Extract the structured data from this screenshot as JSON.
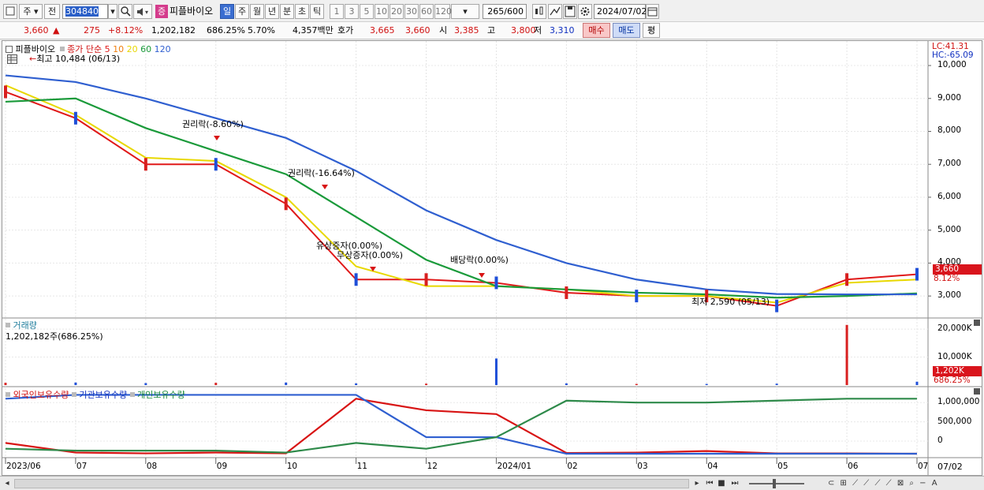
{
  "toolbar": {
    "market_label": "주",
    "prev_label": "전",
    "stock_code": "304840",
    "stock_tag": "증",
    "stock_name": "피플바이오",
    "period_tabs": [
      "일",
      "주",
      "월",
      "년",
      "분",
      "초",
      "틱"
    ],
    "selected_period": "일",
    "interval_buttons": [
      "1",
      "3",
      "5",
      "10",
      "20",
      "30",
      "60",
      "120"
    ],
    "count_display": "265",
    "count_total": "/600",
    "date_value": "2024/07/02"
  },
  "quote": {
    "price": "3,660",
    "change_arrow": "▲",
    "change": "275",
    "change_pct": "+8.12%",
    "volume": "1,202,182",
    "volume_ratio": "686.25%",
    "turnover": "5.70%",
    "amount": "4,357백만",
    "bid_label": "호가",
    "ask_price": "3,665",
    "bid_price": "3,660",
    "open_label": "시",
    "open": "3,385",
    "high_label": "고",
    "high": "3,800",
    "low_label": "저",
    "low": "3,310",
    "buy_button": "매수",
    "sell_button": "매도",
    "eval_button": "평"
  },
  "price_pane": {
    "name": "피플바이오",
    "ma_label": "종가 단순",
    "ma_periods": [
      {
        "label": "5",
        "color": "#e01818"
      },
      {
        "label": "10",
        "color": "#f08010"
      },
      {
        "label": "20",
        "color": "#e8d800"
      },
      {
        "label": "60",
        "color": "#1a9a3a"
      },
      {
        "label": "120",
        "color": "#2f5fd0"
      }
    ],
    "high_marker": "최고 10,484 (06/13)",
    "low_marker": "최저 2,590 (05/13)",
    "events": [
      "권리락(-8.60%)",
      "권리락(-16.64%)",
      "유상증자(0.00%)",
      "무상증자(0.00%)",
      "배당락(0.00%)"
    ],
    "lc_label": "LC:41.31",
    "hc_label": "HC:-65.09",
    "y_ticks": [
      "10,000",
      "9,000",
      "8,000",
      "7,000",
      "6,000",
      "5,000",
      "4,000",
      "3,000"
    ],
    "badge_price": "3,660",
    "badge_pct": "8.12%"
  },
  "volume_pane": {
    "title": "거래량",
    "value": "1,202,182주(686.25%)",
    "y_ticks": [
      "20,000K",
      "10,000K"
    ],
    "badge_value": "1,202K",
    "badge_pct": "686.25%"
  },
  "holdings_pane": {
    "series_labels": [
      "외국인보유수량",
      "기관보유수량",
      "개인보유수량"
    ],
    "y_ticks": [
      "1,000,000",
      "500,000",
      "0"
    ]
  },
  "x_axis": {
    "labels": [
      "2023/06",
      "07",
      "08",
      "09",
      "10",
      "11",
      "12",
      "2024/01",
      "02",
      "03",
      "04",
      "05",
      "06",
      "07"
    ],
    "right_label": "07/02"
  },
  "chart_data": [
    {
      "type": "line",
      "title": "피플바이오",
      "x": [
        "2023/06",
        "07",
        "08",
        "09",
        "10",
        "11",
        "12",
        "2024/01",
        "02",
        "03",
        "04",
        "05",
        "06",
        "07"
      ],
      "series": [
        {
          "name": "종가 단순 5",
          "values": [
            9200,
            8400,
            7000,
            7000,
            5800,
            3500,
            3500,
            3400,
            3100,
            3000,
            3000,
            2700,
            3500,
            3660
          ]
        },
        {
          "name": "종가 단순 20",
          "values": [
            9400,
            8500,
            7200,
            7100,
            6000,
            3900,
            3300,
            3300,
            3200,
            3000,
            3000,
            2800,
            3400,
            3500
          ]
        },
        {
          "name": "종가 단순 60",
          "values": [
            8900,
            9000,
            8100,
            7400,
            6700,
            5400,
            4100,
            3300,
            3200,
            3100,
            3050,
            2950,
            3000,
            3080
          ]
        },
        {
          "name": "종가 단순 120",
          "values": [
            9700,
            9500,
            9000,
            8400,
            7800,
            6800,
            5600,
            4700,
            4000,
            3500,
            3200,
            3060,
            3050,
            3050
          ]
        }
      ],
      "ylim": [
        2500,
        10600
      ]
    },
    {
      "type": "bar",
      "title": "거래량",
      "x": [
        "2023/06",
        "07",
        "08",
        "09",
        "10",
        "11",
        "12",
        "2024/01",
        "02",
        "03",
        "04",
        "05",
        "06",
        "07"
      ],
      "series": [
        {
          "name": "거래량",
          "values": [
            800,
            900,
            700,
            800,
            900,
            600,
            500,
            9500,
            600,
            400,
            400,
            500,
            21500,
            1202
          ]
        }
      ],
      "ylim": [
        0,
        22000
      ]
    },
    {
      "type": "line",
      "x": [
        "2023/06",
        "07",
        "08",
        "09",
        "10",
        "11",
        "12",
        "2024/01",
        "02",
        "03",
        "04",
        "05",
        "06",
        "07"
      ],
      "series": [
        {
          "name": "외국인보유수량",
          "values": [
            -50000,
            -300000,
            -320000,
            -300000,
            -320000,
            1100000,
            800000,
            700000,
            -310000,
            -300000,
            -260000,
            -320000,
            -320000,
            -330000
          ]
        },
        {
          "name": "기관보유수량",
          "values": [
            1100000,
            1200000,
            1200000,
            1200000,
            1200000,
            1200000,
            100000,
            100000,
            -330000,
            -330000,
            -330000,
            -330000,
            -330000,
            -330000
          ]
        },
        {
          "name": "개인보유수량",
          "values": [
            -200000,
            -250000,
            -250000,
            -250000,
            -300000,
            -50000,
            -200000,
            100000,
            1050000,
            1000000,
            1000000,
            1050000,
            1100000,
            1100000
          ]
        }
      ]
    }
  ]
}
